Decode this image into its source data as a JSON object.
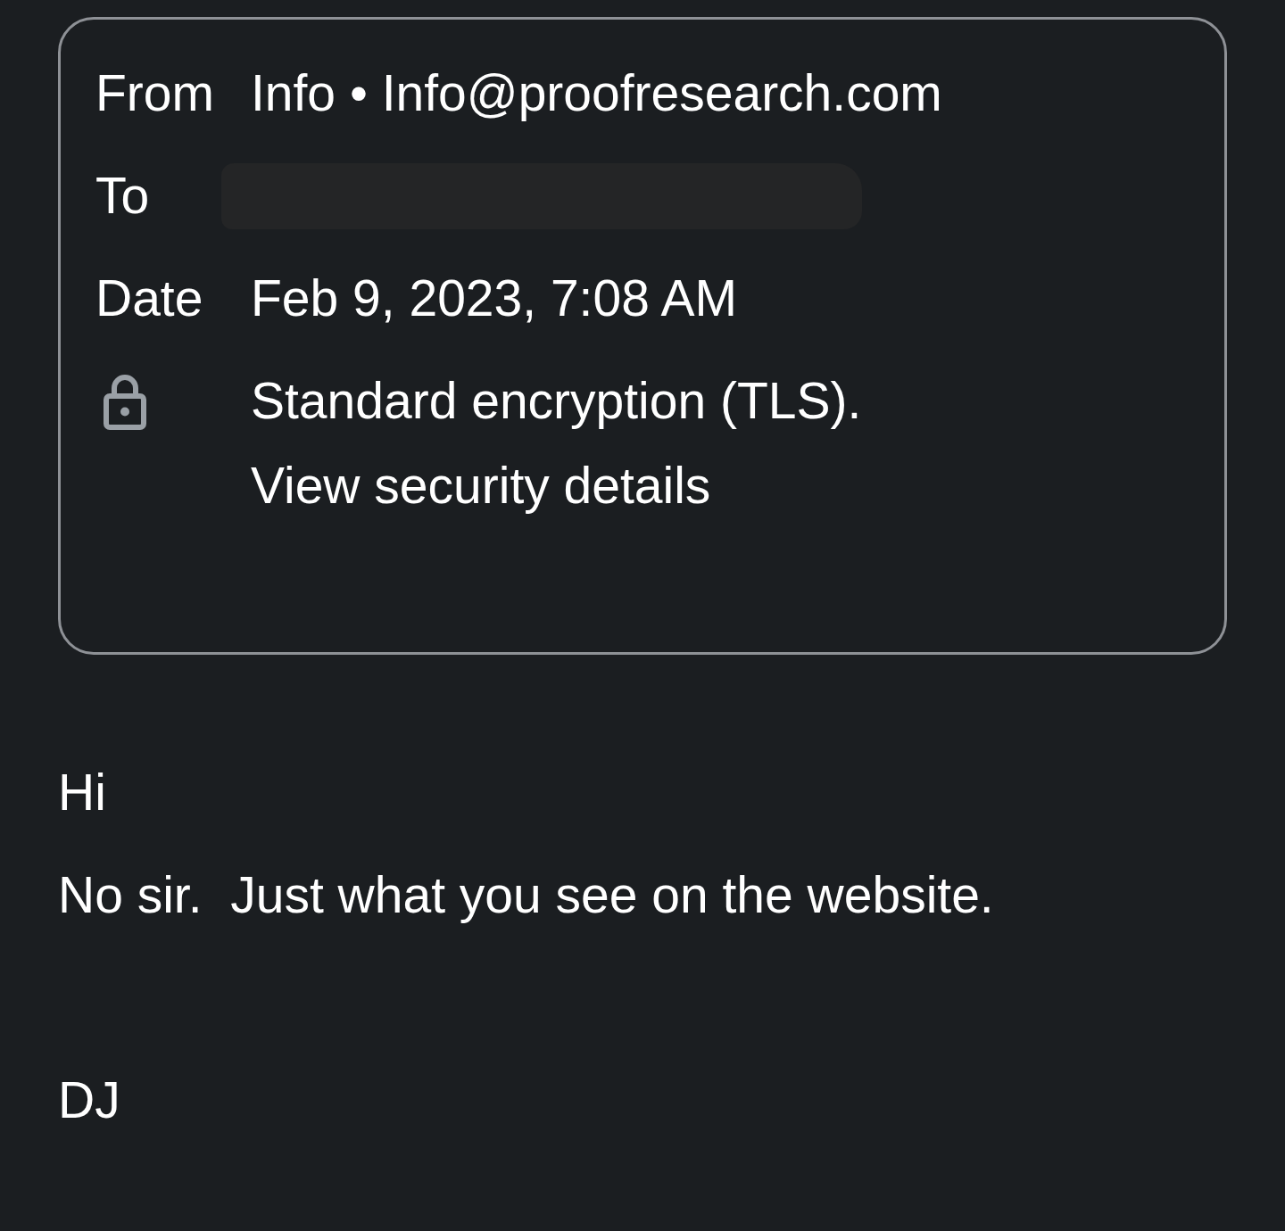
{
  "header": {
    "rows": [
      {
        "label": "From",
        "value": "Info • Info@proofresearch.com"
      },
      {
        "label": "To",
        "redacted": true
      },
      {
        "label": "Date",
        "value": "Feb 9, 2023, 7:08 AM"
      }
    ],
    "security": {
      "text": "Standard encryption (TLS).",
      "link": "View security details"
    }
  },
  "body": {
    "greeting": "Hi",
    "message": "No sir.  Just what you see on the website.",
    "signature": "DJ"
  }
}
